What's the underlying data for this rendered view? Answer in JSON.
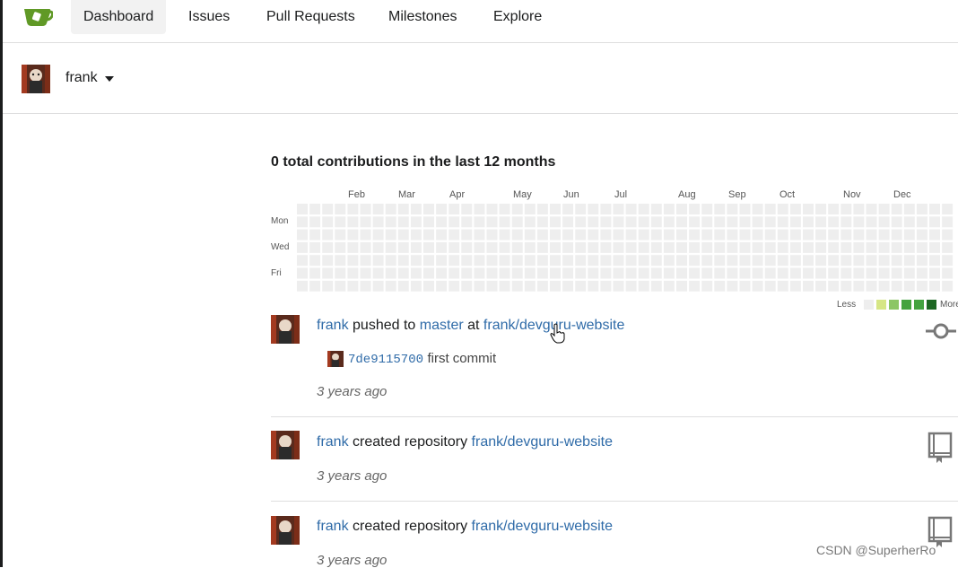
{
  "navbar": {
    "items": [
      {
        "label": "Dashboard",
        "active": true
      },
      {
        "label": "Issues"
      },
      {
        "label": "Pull Requests"
      },
      {
        "label": "Milestones"
      },
      {
        "label": "Explore"
      }
    ]
  },
  "context": {
    "username": "frank"
  },
  "heatmap": {
    "title": "0 total contributions in the last 12 months",
    "months": [
      "Feb",
      "Mar",
      "Apr",
      "May",
      "Jun",
      "Jul",
      "Aug",
      "Sep",
      "Oct",
      "Nov",
      "Dec"
    ],
    "days": [
      "Mon",
      "Wed",
      "Fri"
    ],
    "legend_less": "Less",
    "legend_more": "More",
    "legend_colors": [
      "#eeeeee",
      "#d6e685",
      "#8cc665",
      "#44a340",
      "#1e6823"
    ],
    "empty_color": "#eeeeee",
    "total": 0
  },
  "feed": [
    {
      "user": "frank",
      "action": "pushed to",
      "branch": "master",
      "at": "at",
      "repo": "frank/devguru-website",
      "commit_sha": "7de9115700",
      "commit_message": "first commit",
      "time": "3 years ago",
      "icon": "git-commit-icon"
    },
    {
      "user": "frank",
      "action": "created repository",
      "repo": "frank/devguru-website",
      "time": "3 years ago",
      "icon": "repo-book-icon"
    },
    {
      "user": "frank",
      "action": "created repository",
      "repo": "frank/devguru-website",
      "time": "3 years ago",
      "icon": "repo-book-icon"
    }
  ],
  "watermark": "CSDN @SuperherRo"
}
